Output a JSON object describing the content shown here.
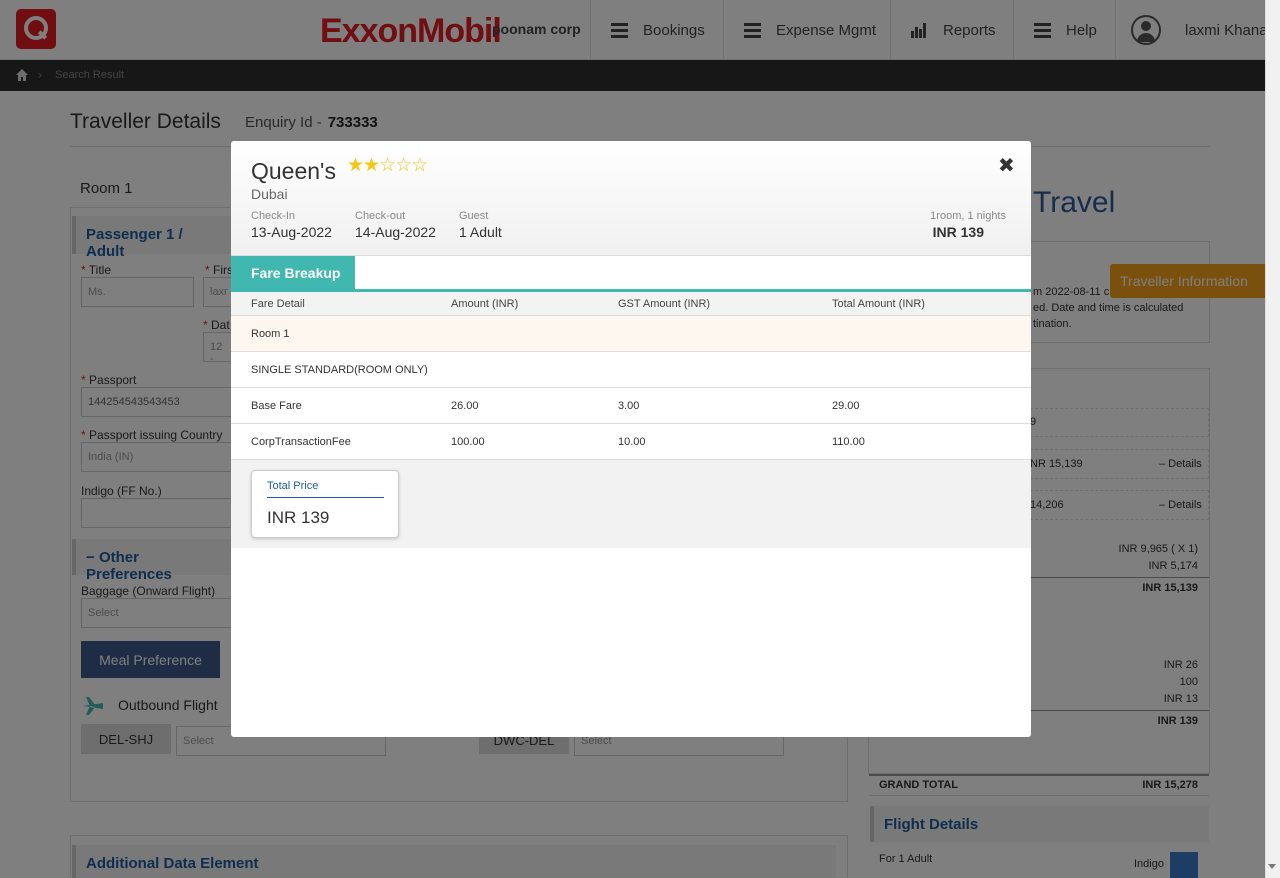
{
  "header": {
    "brand": "ExxonMobil",
    "company": "poonam corp",
    "nav": [
      {
        "label": "Bookings",
        "icon": "menu-icon"
      },
      {
        "label": "Expense Mgmt",
        "icon": "menu-icon"
      },
      {
        "label": "Reports",
        "icon": "bar-chart-icon"
      },
      {
        "label": "Help",
        "icon": "menu-icon"
      }
    ],
    "user": "laxmi Khana"
  },
  "breadcrumb": {
    "current": "Search Result"
  },
  "page": {
    "title": "Traveller Details",
    "enquiry_label": "Enquiry Id -",
    "enquiry_id": "733333",
    "room_label": "Room 1",
    "passenger_heading": "Passenger 1 / Adult",
    "title_label": "Title",
    "title_value": "Ms.",
    "first_label": "Firs",
    "first_value": "laxr",
    "date_label": "Dat",
    "date_value": "12 -",
    "passport_label": "Passport",
    "passport_value": "144254543543453",
    "passport_country_label": "Passport issuing Country",
    "passport_country_value": "India (IN)",
    "ff_label": "Indigo (FF No.)",
    "other_pref_heading": "Other Preferences",
    "baggage_label": "Baggage (Onward Flight)",
    "baggage_placeholder": "Select",
    "meal_button": "Meal Preference",
    "outbound_label": "Outbound Flight",
    "route_out": "DEL-SHJ",
    "route_ret": "DWC-DEL",
    "select_placeholder": "Select",
    "additional_heading": "Additional Data Element"
  },
  "right_panel": {
    "travel_heading": "Travel",
    "info_tab": "Traveller Information",
    "note_lines": [
      "m 2022-08-11 c",
      "ed. Date and time is calculated",
      "tination."
    ],
    "item_9": "9",
    "flight_fare": "NR 15,139",
    "hotel_fare": "14,206",
    "details_label": "– Details",
    "fare_line1": "INR 9,965 ( X 1)",
    "fare_line2": "INR 5,174",
    "fare_total": "INR 15,139",
    "hotel_line1": "INR 26",
    "hotel_line2": "100",
    "hotel_line3": "INR 13",
    "hotel_total": "INR 139",
    "grand_label": "GRAND TOTAL",
    "grand_value": "INR 15,278",
    "flight_details_heading": "Flight Details",
    "for_adult": "For 1 Adult",
    "airline": "Indigo"
  },
  "modal": {
    "hotel_name": "Queen's",
    "rating": 2,
    "max_rating": 5,
    "city": "Dubai",
    "checkin_label": "Check-In",
    "checkin_value": "13-Aug-2022",
    "checkout_label": "Check-out",
    "checkout_value": "14-Aug-2022",
    "guest_label": "Guest",
    "guest_value": "1 Adult",
    "room_nights": "1room, 1 nights",
    "price": "INR 139",
    "tab": "Fare Breakup",
    "columns": [
      "Fare Detail",
      "Amount (INR)",
      "GST Amount (INR)",
      "Total Amount (INR)"
    ],
    "room_row": "Room 1",
    "room_type": "SINGLE STANDARD(ROOM ONLY)",
    "rows": [
      {
        "detail": "Base Fare",
        "amount": "26.00",
        "gst": "3.00",
        "total": "29.00"
      },
      {
        "detail": "CorpTransactionFee",
        "amount": "100.00",
        "gst": "10.00",
        "total": "110.00"
      }
    ],
    "total_label": "Total Price",
    "total_value": "INR 139"
  },
  "colors": {
    "brand": "#e31d25",
    "teal": "#40b8b0",
    "link": "#1f5a9e",
    "star": "#f5c518"
  }
}
